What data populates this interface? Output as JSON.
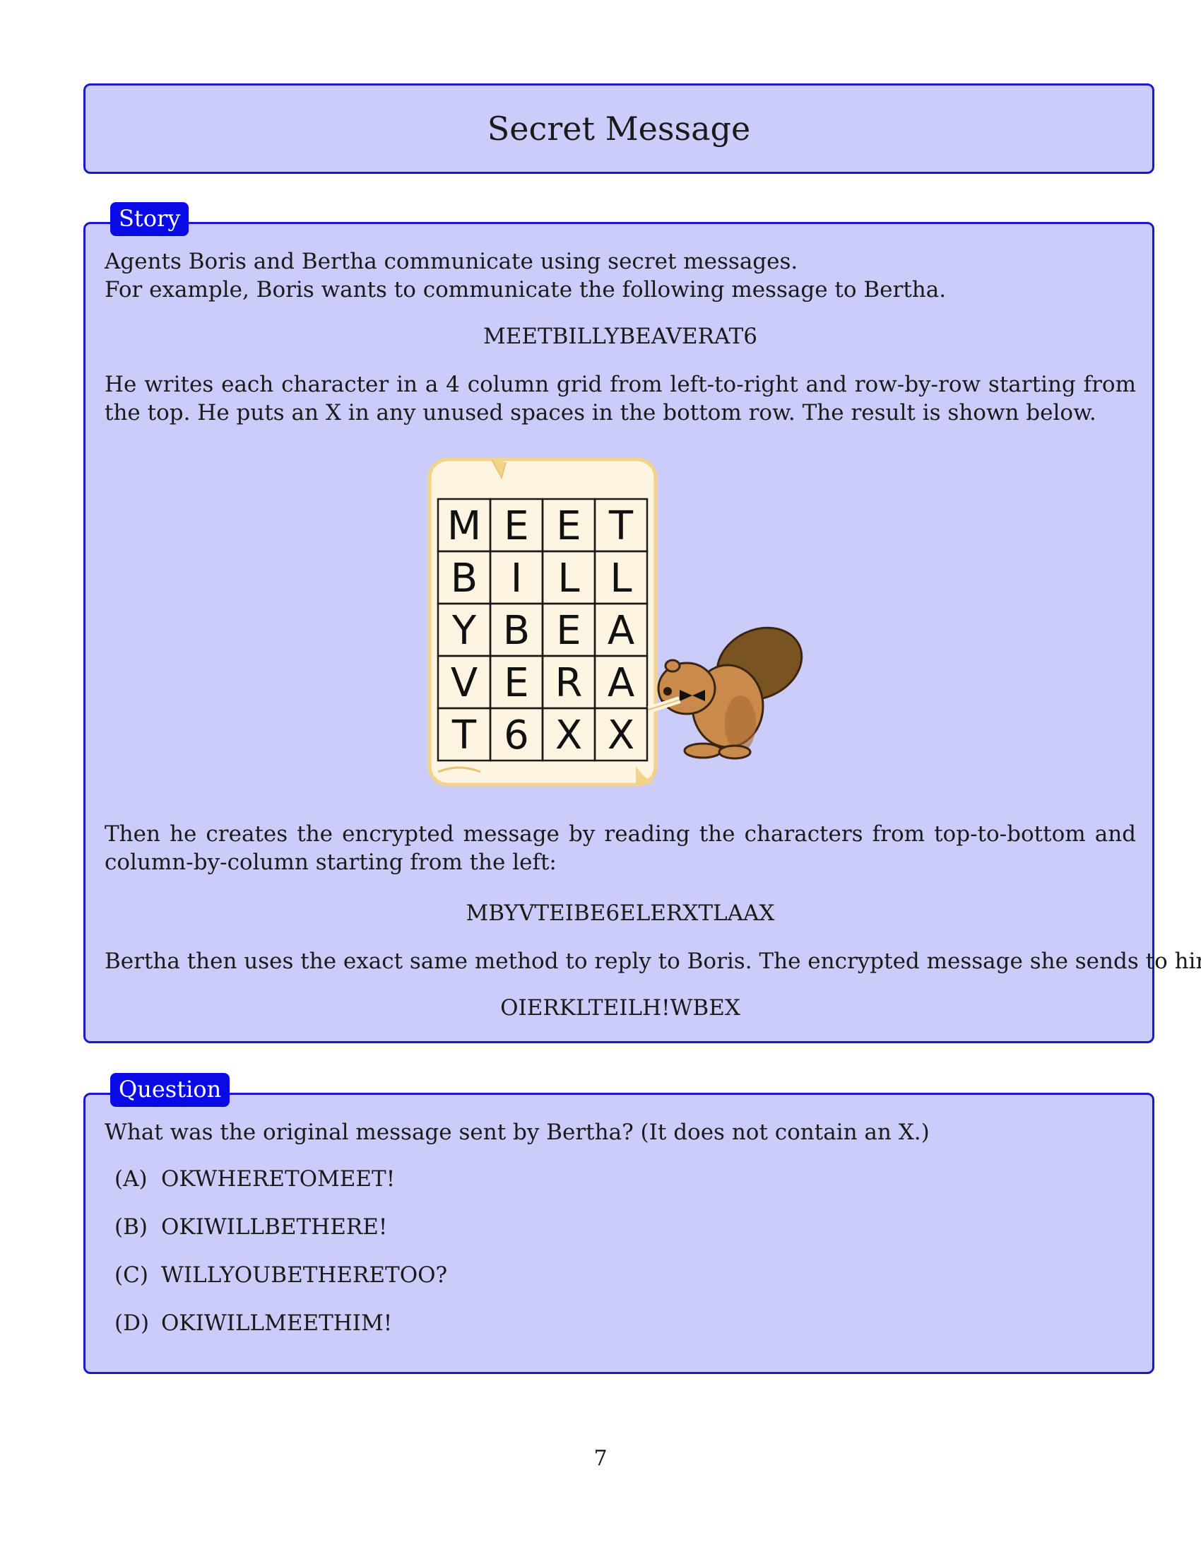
{
  "title": "Secret Message",
  "story": {
    "label": "Story",
    "line1": "Agents Boris and Bertha communicate using secret messages.",
    "line2": "For example, Boris wants to communicate the following message to Bertha.",
    "message": "MEETBILLYBEAVERAT6",
    "para2": "He writes each character in a 4 column grid from left-to-right and row-by-row starting from the top. He puts an X in any unused spaces in the bottom row. The result is shown below.",
    "grid": [
      [
        "M",
        "E",
        "E",
        "T"
      ],
      [
        "B",
        "I",
        "L",
        "L"
      ],
      [
        "Y",
        "B",
        "E",
        "A"
      ],
      [
        "V",
        "E",
        "R",
        "A"
      ],
      [
        "T",
        "6",
        "X",
        "X"
      ]
    ],
    "para3": "Then he creates the encrypted message by reading the characters from top-to-bottom and column-by-column starting from the left:",
    "encrypted": "MBYVTEIBE6ELERXTLAAX",
    "para4": "Bertha then uses the exact same method to reply to Boris. The encrypted message she sends to him is:",
    "reply": "OIERKLTEILH!WBEX"
  },
  "question": {
    "label": "Question",
    "text": "What was the original message sent by Bertha? (It does not contain an X.)",
    "options": [
      {
        "letter": "(A)",
        "text": "OKWHERETOMEET!"
      },
      {
        "letter": "(B)",
        "text": "OKIWILLBETHERE!"
      },
      {
        "letter": "(C)",
        "text": "WILLYOUBETHERETOO?"
      },
      {
        "letter": "(D)",
        "text": "OKIWILLMEETHIM!"
      }
    ]
  },
  "page_number": "7",
  "colors": {
    "box_fill": "#ccccfa",
    "box_border": "#1a1ac8",
    "label_fill": "#0a0ae6",
    "scroll_fill": "#fdf5e1",
    "beaver": "#c98a4b"
  }
}
